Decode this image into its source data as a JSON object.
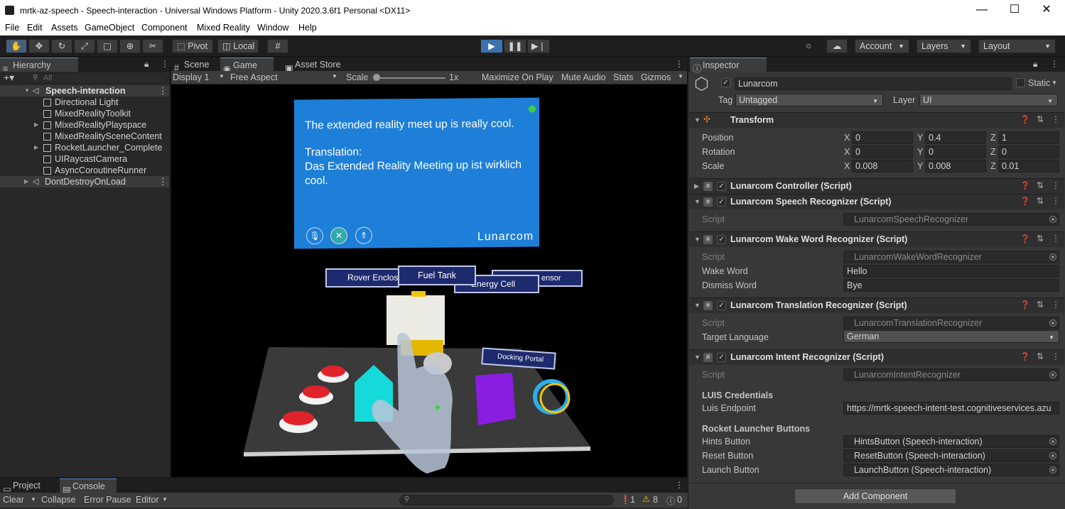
{
  "window": {
    "title": "mrtk-az-speech - Speech-interaction - Universal Windows Platform - Unity 2020.3.6f1 Personal <DX11>",
    "minimize": "—",
    "maximize": "☐",
    "close": "✕"
  },
  "menu": [
    "File",
    "Edit",
    "Assets",
    "GameObject",
    "Component",
    "Mixed Reality",
    "Window",
    "Help"
  ],
  "toolbar": {
    "pivot": "Pivot",
    "local": "Local",
    "account": "Account",
    "layers": "Layers",
    "layout": "Layout"
  },
  "hierarchy": {
    "title": "Hierarchy",
    "search_placeholder": "All",
    "scene": "Speech-interaction",
    "items": [
      "Directional Light",
      "MixedRealityToolkit",
      "MixedRealityPlayspace",
      "MixedRealitySceneContent",
      "RocketLauncher_Complete",
      "UIRaycastCamera",
      "AsyncCoroutineRunner"
    ],
    "dont_destroy": "DontDestroyOnLoad"
  },
  "game": {
    "tab_scene": "Scene",
    "tab_game": "Game",
    "tab_asset_store": "Asset Store",
    "display": "Display 1",
    "aspect": "Free Aspect",
    "scale_label": "Scale",
    "scale_value": "1x",
    "maximize_on_play": "Maximize On Play",
    "mute_audio": "Mute Audio",
    "stats": "Stats",
    "gizmos": "Gizmos",
    "panel": {
      "line1": "The extended reality meet up is really cool.",
      "line2": "Translation:",
      "line3": "Das Extended Reality Meeting up ist wirklich cool.",
      "brand": "Lunarcom"
    },
    "labels": {
      "rover": "Rover Enclosu",
      "fuel": "Fuel Tank",
      "energy": "Energy Cell",
      "sensor": "ensor",
      "docking": "Docking Portal"
    }
  },
  "inspector": {
    "title": "Inspector",
    "object_name": "Lunarcom",
    "static": "Static",
    "tag_label": "Tag",
    "tag_value": "Untagged",
    "layer_label": "Layer",
    "layer_value": "UI",
    "transform": {
      "title": "Transform",
      "position_label": "Position",
      "rotation_label": "Rotation",
      "scale_label": "Scale",
      "position": {
        "x": "0",
        "y": "0.4",
        "z": "1"
      },
      "rotation": {
        "x": "0",
        "y": "0",
        "z": "0"
      },
      "scale": {
        "x": "0.008",
        "y": "0.008",
        "z": "0.01"
      }
    },
    "components": {
      "controller": "Lunarcom Controller (Script)",
      "speech": "Lunarcom Speech Recognizer (Script)",
      "speech_script": "LunarcomSpeechRecognizer",
      "wake": "Lunarcom Wake Word Recognizer (Script)",
      "wake_script": "LunarcomWakeWordRecognizer",
      "wake_word_label": "Wake Word",
      "wake_word": "Hello",
      "dismiss_word_label": "Dismiss Word",
      "dismiss_word": "Bye",
      "translation": "Lunarcom Translation Recognizer (Script)",
      "translation_script": "LunarcomTranslationRecognizer",
      "target_language_label": "Target Language",
      "target_language": "German",
      "intent": "Lunarcom Intent Recognizer (Script)",
      "intent_script": "LunarcomIntentRecognizer",
      "script_label": "Script",
      "luis_header": "LUIS Credentials",
      "luis_endpoint_label": "Luis Endpoint",
      "luis_endpoint": "https://mrtk-speech-intent-test.cognitiveservices.azu",
      "rocket_header": "Rocket Launcher Buttons",
      "hints_label": "Hints Button",
      "hints": "HintsButton (Speech-interaction)",
      "reset_label": "Reset Button",
      "reset": "ResetButton (Speech-interaction)",
      "launch_label": "Launch Button",
      "launch": "LaunchButton (Speech-interaction)"
    },
    "add_component": "Add Component"
  },
  "bottom": {
    "tab_project": "Project",
    "tab_console": "Console",
    "clear": "Clear",
    "collapse": "Collapse",
    "error_pause": "Error Pause",
    "editor": "Editor",
    "count_errors": "1",
    "count_warnings": "8",
    "count_info": "0"
  },
  "colors": {
    "accent": "#2c5d87",
    "panel_blue": "#1e7fd8",
    "play_active": "#3a72b0"
  }
}
